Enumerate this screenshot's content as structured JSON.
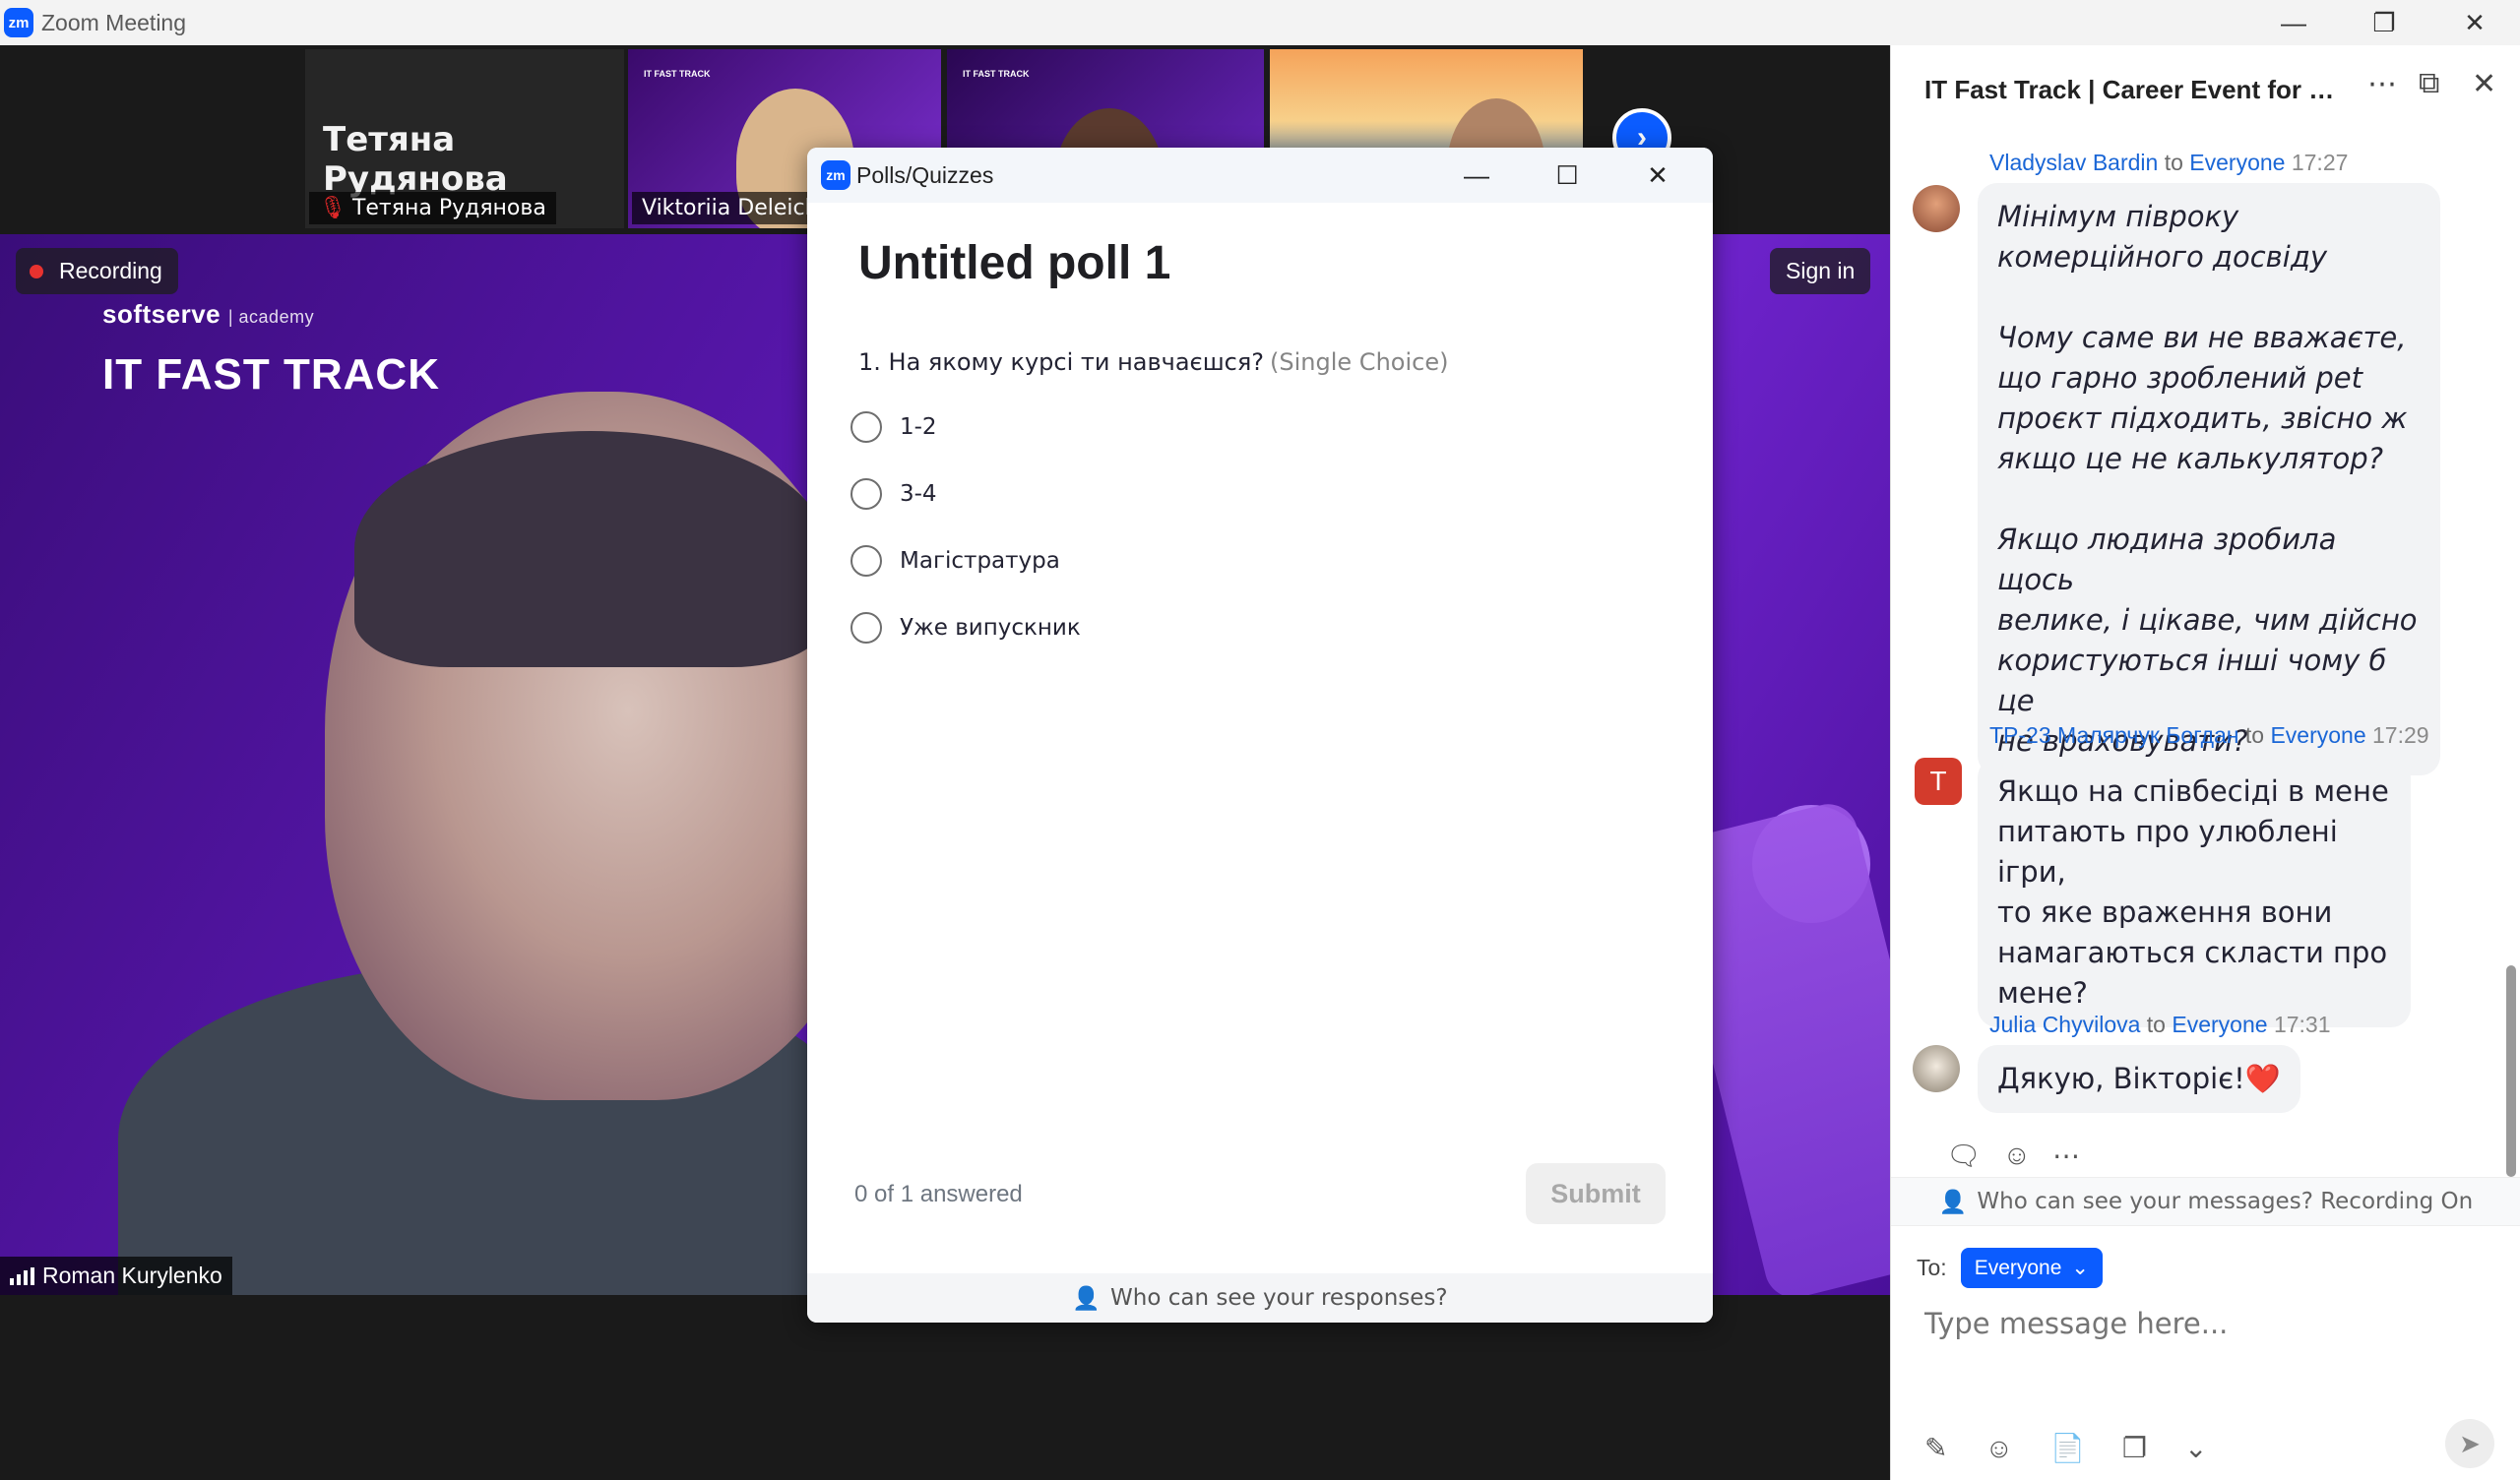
{
  "window": {
    "app_icon": "zm",
    "title": "Zoom Meeting",
    "controls": [
      "minimize-icon",
      "restore-icon",
      "close-icon"
    ]
  },
  "thumbnails": [
    {
      "big_name": "Тетяна Рудянова",
      "label": "Тетяна Рудянова",
      "muted": true
    },
    {
      "label": "Viktoriia Deleich"
    },
    {
      "label": ""
    },
    {
      "label": ""
    }
  ],
  "main_video": {
    "recording_label": "Recording",
    "sign_in_label": "Sign in",
    "brand_line1": "softserve",
    "brand_line1_sub": "| academy",
    "brand_line2": "IT FAST TRACK",
    "speaker_name": "Roman Kurylenko"
  },
  "poll": {
    "window_title": "Polls/Quizzes",
    "heading": "Untitled poll 1",
    "question": "1. На якому курсі ти навчаєшся?",
    "question_type": "(Single Choice)",
    "options": [
      "1-2",
      "3-4",
      "Магістратура",
      "Уже випускник"
    ],
    "progress": "0 of 1 answered",
    "submit_label": "Submit",
    "footer": "Who can see your responses?"
  },
  "chat": {
    "title": "IT Fast Track | Career Event for St...",
    "messages": [
      {
        "sender": "Vladyslav Bardin",
        "to": "to",
        "recipient": "Everyone",
        "time": "17:27",
        "text": "Мінімум півроку\nкомерційного досвіду\n\nЧому саме ви не вважаєте,\nщо гарно зроблений pet\nпроєкт підходить, звісно ж\nякщо це не калькулятор?\n\nЯкщо людина зробила щось\nвелике, і цікаве, чим дійсно\nкористуються інші чому б це\nне враховувати?"
      },
      {
        "sender": "ТР-23 Малярчук Богдан",
        "to": "to",
        "recipient": "Everyone",
        "time": "17:29",
        "avatar_letter": "T",
        "text": "Якщо на співбесіді в мене\nпитають про улюблені ігри,\nто яке враження вони\nнамагаються скласти про\nмене?"
      },
      {
        "sender": "Julia Chyvilova",
        "to": "to",
        "recipient": "Everyone",
        "time": "17:31",
        "text": "Дякую, Вікторіє!❤️"
      }
    ],
    "visibility": "Who can see your messages? Recording On",
    "to_label": "To:",
    "recipient_button": "Everyone",
    "input_placeholder": "Type message here..."
  },
  "colors": {
    "zoom_blue": "#0b5cff",
    "recording_red": "#e8322f",
    "link_blue": "#1a66d6"
  }
}
